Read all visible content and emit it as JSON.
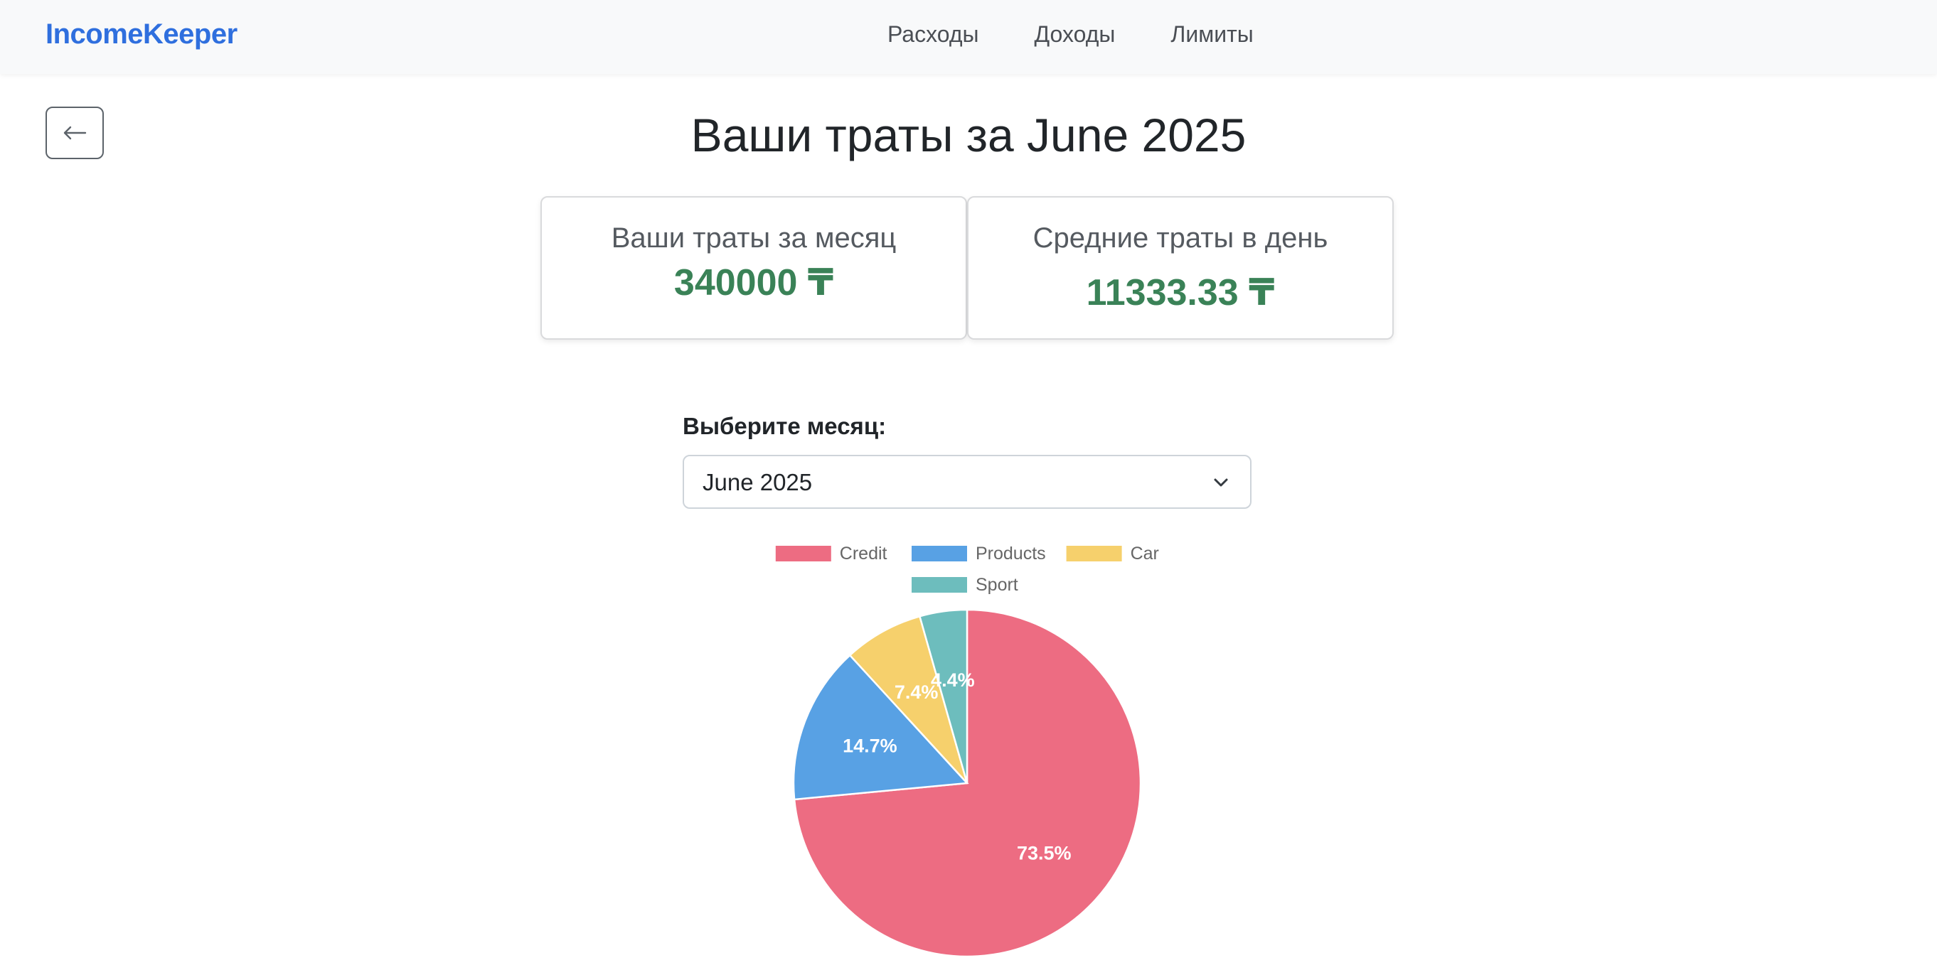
{
  "navbar": {
    "brand": "IncomeKeeper",
    "links": [
      "Расходы",
      "Доходы",
      "Лимиты"
    ]
  },
  "page": {
    "title": "Ваши траты за June 2025"
  },
  "cards": {
    "monthly": {
      "title": "Ваши траты за месяц",
      "value": "340000 ₸"
    },
    "daily": {
      "title": "Средние траты в день",
      "value": "11333.33 ₸"
    }
  },
  "month_select": {
    "label": "Выберите месяц:",
    "value": "June 2025"
  },
  "icons": {
    "back": "arrow-left-icon",
    "dropdown": "chevron-down-icon"
  },
  "colors": {
    "brand": "#2f6fde",
    "value_green": "#3a8257"
  },
  "chart_data": {
    "type": "pie",
    "categories": [
      "Credit",
      "Products",
      "Car",
      "Sport"
    ],
    "values": [
      73.5,
      14.7,
      7.4,
      4.4
    ],
    "labels": [
      "73.5%",
      "14.7%",
      "7.4%",
      "4.4%"
    ],
    "colors": [
      "#ed6c82",
      "#58a1e4",
      "#f6d06c",
      "#6dbdbd"
    ],
    "legend_position": "top"
  }
}
